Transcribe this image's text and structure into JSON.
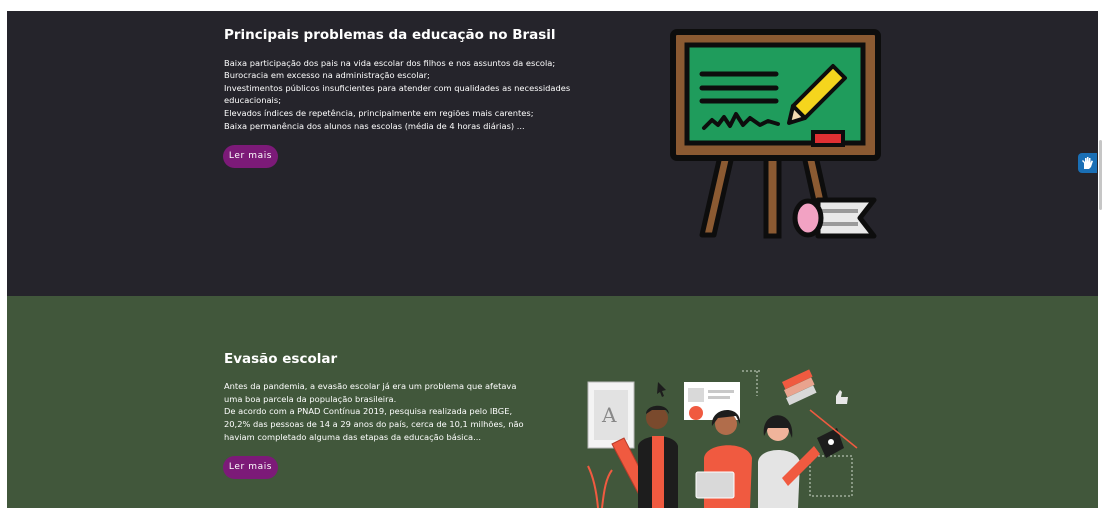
{
  "sections": {
    "problems": {
      "title": "Principais problemas da educação no Brasil",
      "lines": [
        "Baixa participação dos pais na vida escolar dos filhos e nos assuntos da escola;",
        "Burocracia em excesso na administração escolar;",
        "Investimentos públicos insuficientes para atender com qualidades as necessidades",
        "educacionais;",
        "Elevados índices de repetência, principalmente em regiões mais carentes;",
        "Baixa permanência dos alunos nas escolas (média de 4 horas diárias) ..."
      ],
      "button_label": "Ler mais"
    },
    "dropout": {
      "title": "Evasão escolar",
      "lines": [
        "Antes da pandemia, a evasão escolar já era um problema que afetava",
        "uma boa parcela da população brasileira.",
        "De acordo com a PNAD Contínua 2019, pesquisa realizada pelo IBGE,",
        "20,2% das pessoas de 14 a 29 anos do país, cerca de 10,1 milhões, não",
        "haviam completado alguma das etapas da educação básica..."
      ],
      "button_label": "Ler mais"
    }
  },
  "widgets": {
    "accessibility_icon": "accessibility-hand-icon"
  },
  "colors": {
    "dark_section": "#25242b",
    "green_section": "#41573b",
    "button": "#7c1a78",
    "chalkboard": "#1f9c5c",
    "frame": "#8b5a32",
    "accessibility": "#1a6fb5"
  }
}
